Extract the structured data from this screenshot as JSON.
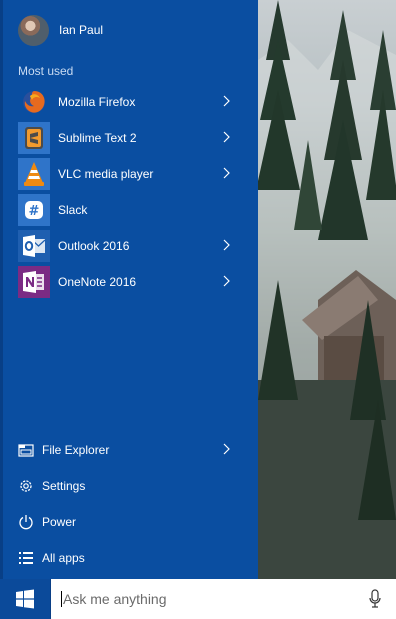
{
  "user": {
    "name": "Ian Paul"
  },
  "most_used": {
    "title": "Most used",
    "items": [
      {
        "label": "Mozilla Firefox",
        "icon": "firefox-icon",
        "tile_color": "#0a4ea1"
      },
      {
        "label": "Sublime Text 2",
        "icon": "sublime-text-icon",
        "tile_color": "#2f74c9"
      },
      {
        "label": "VLC media player",
        "icon": "vlc-icon",
        "tile_color": "#2f74c9"
      },
      {
        "label": "Slack",
        "icon": "slack-icon",
        "tile_color": "#2f74c9"
      },
      {
        "label": "Outlook 2016",
        "icon": "outlook-icon",
        "tile_color": "#1f5fb0"
      },
      {
        "label": "OneNote 2016",
        "icon": "onenote-icon",
        "tile_color": "#7b2b84"
      }
    ]
  },
  "bottom": {
    "items": [
      {
        "label": "File Explorer",
        "icon": "folder-icon"
      },
      {
        "label": "Settings",
        "icon": "gear-icon"
      },
      {
        "label": "Power",
        "icon": "power-icon"
      },
      {
        "label": "All apps",
        "icon": "list-icon"
      }
    ]
  },
  "taskbar": {
    "search_placeholder": "Ask me anything",
    "start_icon": "windows-logo-icon",
    "mic_icon": "microphone-icon"
  },
  "colors": {
    "start_bg": "#0a4ea1",
    "taskbar_bg": "#0a3f86"
  }
}
